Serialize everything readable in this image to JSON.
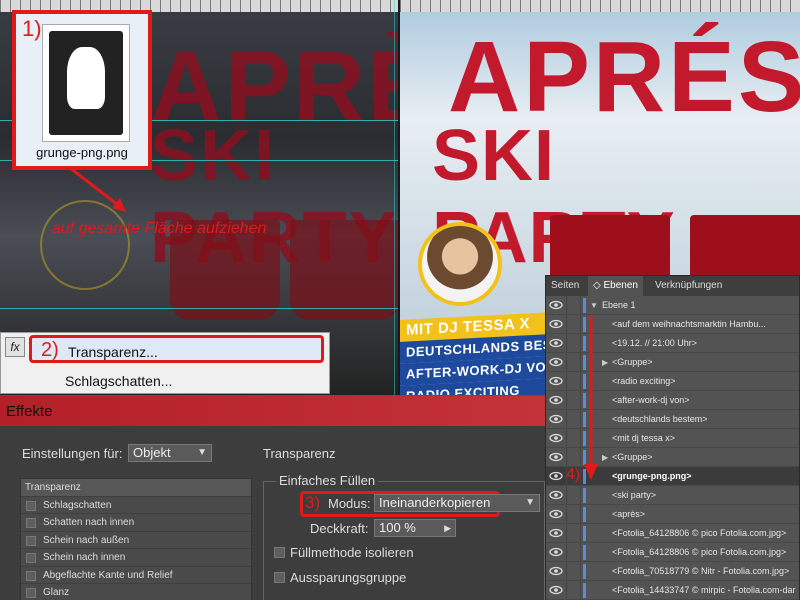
{
  "left_document": {
    "headline_1": "APRÈS",
    "headline_2": "SKI PARTY"
  },
  "right_document": {
    "headline_1": "APRÉS",
    "headline_2": "SKI PARTY",
    "band_1": "MIT DJ TESSA X",
    "band_2": "DEUTSCHLANDS BESTE",
    "band_3": "AFTER-WORK-DJ VON",
    "band_4": "RADIO EXCITING"
  },
  "file_callout": {
    "step": "1)",
    "filename": "grunge-png.png"
  },
  "annotation": {
    "text": "auf gesamte Fläche aufziehen"
  },
  "context_menu": {
    "fx_label": "fx",
    "step": "2)",
    "items": [
      "Transparenz...",
      "Schlagschatten..."
    ]
  },
  "effects_dialog": {
    "title": "Effekte",
    "settings_label": "Einstellungen für:",
    "settings_value": "Objekt",
    "section_title": "Transparenz",
    "effects_list": [
      "Transparenz",
      "Schlagschatten",
      "Schatten nach innen",
      "Schein nach außen",
      "Schein nach innen",
      "Abgeflachte Kante und Relief",
      "Glanz"
    ],
    "group_title": "Einfaches Füllen",
    "step": "3)",
    "mode_label": "Modus:",
    "mode_value": "Ineinanderkopieren",
    "opacity_label": "Deckkraft:",
    "opacity_value": "100 %",
    "isolate_label": "Füllmethode isolieren",
    "knockout_label": "Aussparungsgruppe"
  },
  "layers_panel": {
    "tabs": [
      "Seiten",
      "Ebenen",
      "Verknüpfungen"
    ],
    "active_tab": "Ebenen",
    "step": "4)",
    "layer_name": "Ebene 1",
    "rows": [
      "<auf dem weihnachtsmarktin Hambu...",
      "<19.12. // 21:00 Uhr>",
      "<Gruppe>",
      "<radio exciting>",
      "<after-work-dj von>",
      "<deutschlands bestem>",
      "<mit dj tessa x>",
      "<Gruppe>",
      "<grunge-png.png>",
      "<ski party>",
      "<après>",
      "<Fotolia_64128806 © pico Fotolia.com.jpg>",
      "<Fotolia_64128806 © pico Fotolia.com.jpg>",
      "<Fotolia_70518779 © Nitr - Fotolia.com.jpg>",
      "<Fotolia_14433747 © mirpic - Fotolia.com-dar"
    ]
  },
  "colors": {
    "annotation_red": "#e01a1a",
    "flyer_red": "#c2192c",
    "flyer_yellow": "#f2c21a",
    "flyer_blue": "#1d4a9c",
    "dialog_title_red": "#b32027",
    "layer_color_blue": "#5a8ad8"
  }
}
